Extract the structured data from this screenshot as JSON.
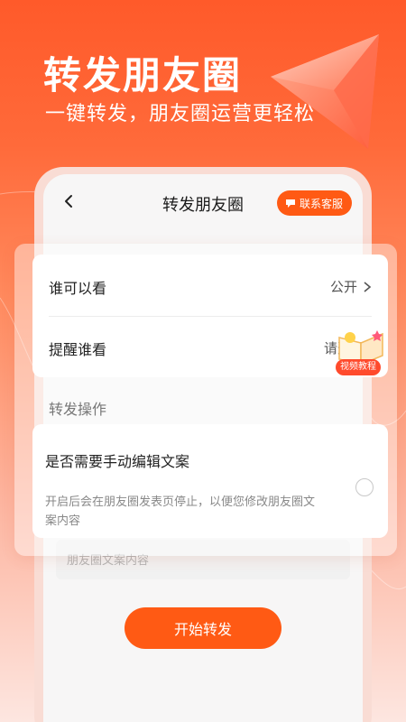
{
  "promo": {
    "title": "转发朋友圈",
    "subtitle": "一键转发，朋友圈运营更轻松"
  },
  "nav": {
    "title": "转发朋友圈",
    "contact_label": "联系客服"
  },
  "settings": {
    "visibility_label": "谁可以看",
    "visibility_value": "公开",
    "remind_label": "提醒谁看",
    "remind_value": "请选择"
  },
  "section": {
    "label": "转发操作"
  },
  "manual_edit": {
    "title": "是否需要手动编辑文案",
    "description": "开启后会在朋友圈发表页停止，以便您修改朋友圈文案内容"
  },
  "background_field": {
    "placeholder": "朋友圈文案内容"
  },
  "actions": {
    "start_label": "开始转发"
  },
  "video_tutorial": {
    "label": "视频教程"
  },
  "colors": {
    "accent": "#ff5a14",
    "header_gradient_top": "#ff5a2a"
  }
}
